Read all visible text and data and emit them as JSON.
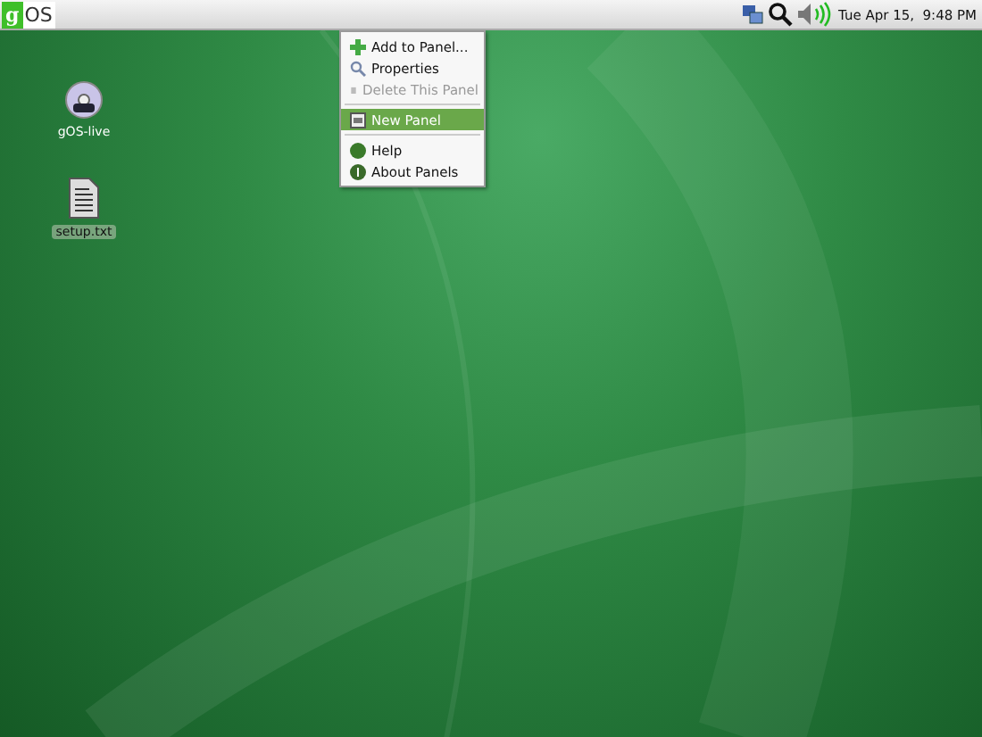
{
  "top_panel": {
    "logo_letter": "g",
    "logo_text": "OS",
    "clock": "Tue Apr 15,  9:48 PM"
  },
  "desktop_icons": [
    {
      "kind": "disc",
      "label": "gOS-live",
      "selected": false
    },
    {
      "kind": "text-file",
      "label": "setup.txt",
      "selected": true
    }
  ],
  "context_menu": [
    {
      "kind": "item",
      "label": "Add to Panel...",
      "disabled": false,
      "selected": false
    },
    {
      "kind": "item",
      "label": "Properties",
      "disabled": false,
      "selected": false
    },
    {
      "kind": "item",
      "label": "Delete This Panel",
      "disabled": true,
      "selected": false
    },
    {
      "kind": "separator"
    },
    {
      "kind": "item",
      "label": "New Panel",
      "disabled": false,
      "selected": true
    },
    {
      "kind": "separator"
    },
    {
      "kind": "item",
      "label": "Help",
      "disabled": false,
      "selected": false
    },
    {
      "kind": "item",
      "label": "About Panels",
      "disabled": false,
      "selected": false
    }
  ]
}
